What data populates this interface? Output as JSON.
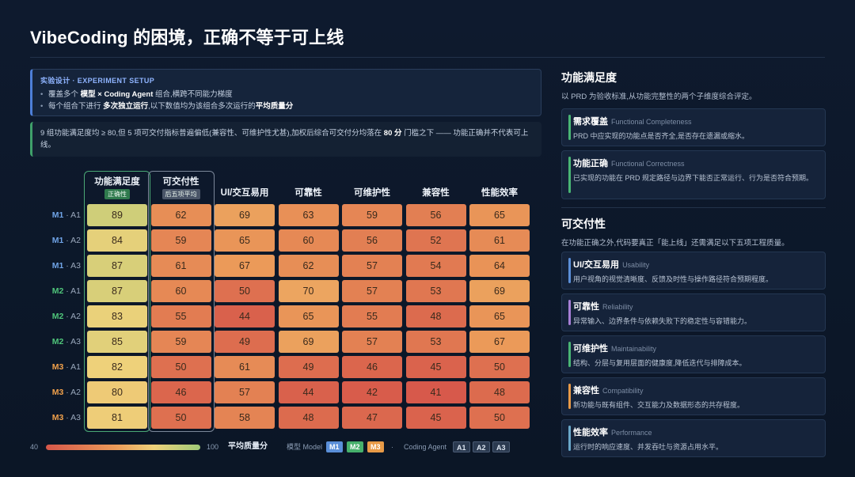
{
  "title": "VibeCoding 的困境，正确不等于可上线",
  "setup": {
    "heading": "实验设计 · EXPERIMENT SETUP",
    "line1": [
      {
        "t": "覆盖多个 "
      },
      {
        "t": "模型 × Coding Agent",
        "b": true
      },
      {
        "t": " 组合,横跨不同能力梯度"
      }
    ],
    "line2": [
      {
        "t": "每个组合下进行 "
      },
      {
        "t": "多次独立运行",
        "b": true
      },
      {
        "t": ",以下数值均为该组合多次运行的"
      },
      {
        "t": "平均质量分",
        "b": true
      }
    ]
  },
  "note": [
    {
      "t": "9 组功能满足度均 ≥ 80,但 5 项可交付指标普遍偏低(兼容性、可维护性尤甚),加权后综合可交付分均落在 "
    },
    {
      "t": "80 分",
      "b": true
    },
    {
      "t": " 门槛之下 —— 功能正确并不代表可上线。"
    }
  ],
  "heatmap": {
    "columns": [
      {
        "label": "功能满足度",
        "tag": "正确性",
        "tag_style": "green"
      },
      {
        "label": "可交付性",
        "tag": "后五项平均",
        "tag_style": "gray"
      },
      {
        "label": "UI/交互易用"
      },
      {
        "label": "可靠性"
      },
      {
        "label": "可维护性"
      },
      {
        "label": "兼容性"
      },
      {
        "label": "性能效率"
      }
    ],
    "rows": [
      {
        "model": "M1",
        "agent": "A1",
        "model_color": "#6fa3e6",
        "values": [
          89,
          62,
          69,
          63,
          59,
          56,
          65
        ]
      },
      {
        "model": "M1",
        "agent": "A2",
        "model_color": "#6fa3e6",
        "values": [
          84,
          59,
          65,
          60,
          56,
          52,
          61
        ]
      },
      {
        "model": "M1",
        "agent": "A3",
        "model_color": "#6fa3e6",
        "values": [
          87,
          61,
          67,
          62,
          57,
          54,
          64
        ]
      },
      {
        "model": "M2",
        "agent": "A1",
        "model_color": "#4fc47a",
        "values": [
          87,
          60,
          50,
          70,
          57,
          53,
          69
        ]
      },
      {
        "model": "M2",
        "agent": "A2",
        "model_color": "#4fc47a",
        "values": [
          83,
          55,
          44,
          65,
          55,
          48,
          65
        ]
      },
      {
        "model": "M2",
        "agent": "A3",
        "model_color": "#4fc47a",
        "values": [
          85,
          59,
          49,
          69,
          57,
          53,
          67
        ]
      },
      {
        "model": "M3",
        "agent": "A1",
        "model_color": "#f0a04b",
        "values": [
          82,
          50,
          61,
          49,
          46,
          45,
          50
        ]
      },
      {
        "model": "M3",
        "agent": "A2",
        "model_color": "#f0a04b",
        "values": [
          80,
          46,
          57,
          44,
          42,
          41,
          48
        ]
      },
      {
        "model": "M3",
        "agent": "A3",
        "model_color": "#f0a04b",
        "values": [
          81,
          50,
          58,
          48,
          47,
          45,
          50
        ]
      }
    ],
    "separator": "·",
    "scale": [
      40,
      100
    ],
    "highlight_colors": [
      "#4aa875",
      "#7b8799"
    ]
  },
  "legend": {
    "min": "40",
    "max": "100",
    "label": "平均质量分",
    "model_label": "模型 Model",
    "models": [
      {
        "name": "M1",
        "color": "#5a8fd9"
      },
      {
        "name": "M2",
        "color": "#46b06c"
      },
      {
        "name": "M3",
        "color": "#e89a47"
      }
    ],
    "dot": "·",
    "agent_label": "Coding Agent",
    "agents": [
      "A1",
      "A2",
      "A3"
    ]
  },
  "right": {
    "func": {
      "heading": "功能满足度",
      "sub": "以 PRD 为验收标准,从功能完整性的两个子维度综合评定。",
      "cards": [
        {
          "title": "需求覆盖",
          "en": "Functional Completeness",
          "desc": "PRD 中应实现的功能点是否齐全,是否存在遗漏或缩水。",
          "color": "#49b574"
        },
        {
          "title": "功能正确",
          "en": "Functional Correctness",
          "desc": "已实现的功能在 PRD 规定路径与边界下能否正常运行、行为是否符合预期。",
          "color": "#49b574"
        }
      ]
    },
    "deliv": {
      "heading": "可交付性",
      "sub": "在功能正确之外,代码要真正「能上线」还需满足以下五项工程质量。",
      "cards": [
        {
          "title": "UI/交互易用",
          "en": "Usability",
          "desc": "用户视角的视觉清晰度、反馈及时性与操作路径符合预期程度。",
          "color": "#5b8fd8"
        },
        {
          "title": "可靠性",
          "en": "Reliability",
          "desc": "异常输入、边界条件与依赖失败下的稳定性与容错能力。",
          "color": "#a77fd6"
        },
        {
          "title": "可维护性",
          "en": "Maintainability",
          "desc": "结构、分层与复用层面的健康度,降低迭代与排障成本。",
          "color": "#49b574"
        },
        {
          "title": "兼容性",
          "en": "Compatibility",
          "desc": "新功能与既有组件、交互能力及数据形态的共存程度。",
          "color": "#e89a47"
        },
        {
          "title": "性能效率",
          "en": "Performance",
          "desc": "运行时的响应速度、并发吞吐与资源占用水平。",
          "color": "#6aa8c9"
        }
      ]
    }
  }
}
